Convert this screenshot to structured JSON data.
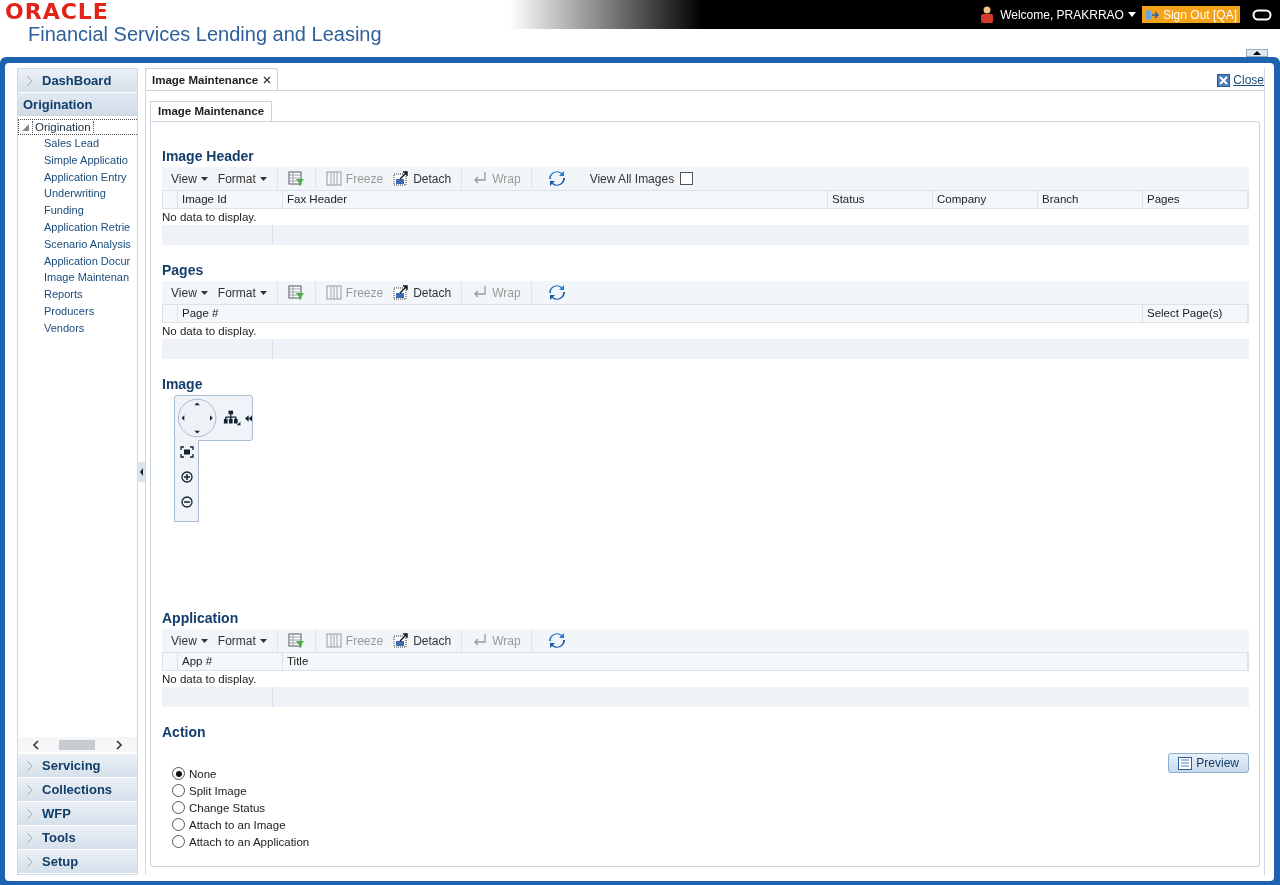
{
  "header": {
    "logo": "ORACLE",
    "product": "Financial Services Lending and Leasing",
    "welcome": "Welcome, PRAKRRAO",
    "sign_out": "Sign Out [QA]"
  },
  "sidebar": {
    "top_sections": [
      {
        "label": "DashBoard"
      }
    ],
    "active_section": "Origination",
    "tree": {
      "label": "Origination",
      "expanded": true,
      "children": [
        {
          "label": "Sales Lead"
        },
        {
          "label": "Simple Applicatio"
        },
        {
          "label": "Application Entry"
        },
        {
          "label": "Underwriting"
        },
        {
          "label": "Funding"
        },
        {
          "label": "Application Retrie"
        },
        {
          "label": "Scenario Analysis"
        },
        {
          "label": "Application Docur"
        },
        {
          "label": "Image Maintenan"
        },
        {
          "label": "Reports"
        },
        {
          "label": "Producers"
        },
        {
          "label": "Vendors"
        }
      ]
    },
    "bottom_sections": [
      {
        "label": "Servicing"
      },
      {
        "label": "Collections"
      },
      {
        "label": "WFP"
      },
      {
        "label": "Tools"
      },
      {
        "label": "Setup"
      }
    ]
  },
  "tabs": [
    {
      "label": "Image Maintenance",
      "selected": true
    }
  ],
  "close_link": "Close",
  "sub_tabs": [
    {
      "label": "Image Maintenance",
      "selected": true
    }
  ],
  "sections": [
    {
      "kind": "table",
      "title": "Image Header",
      "toolbar": [
        {
          "kind": "menu",
          "label": "View"
        },
        {
          "kind": "menu",
          "label": "Format"
        },
        {
          "kind": "filter"
        },
        {
          "kind": "freeze",
          "label": "Freeze",
          "disabled": true
        },
        {
          "kind": "detach",
          "label": "Detach",
          "disabled": false
        },
        {
          "kind": "wrap",
          "label": "Wrap",
          "disabled": true
        },
        {
          "kind": "refresh"
        }
      ],
      "view_all_images": {
        "label": "View All Images",
        "checked": false
      },
      "columns": [
        "Image Id",
        "Fax Header",
        "Status",
        "Company",
        "Branch",
        "Pages"
      ],
      "empty_text": "No data to display."
    },
    {
      "kind": "table",
      "title": "Pages",
      "toolbar": [
        {
          "kind": "menu",
          "label": "View"
        },
        {
          "kind": "menu",
          "label": "Format"
        },
        {
          "kind": "filter"
        },
        {
          "kind": "freeze",
          "label": "Freeze",
          "disabled": true
        },
        {
          "kind": "detach",
          "label": "Detach",
          "disabled": false
        },
        {
          "kind": "wrap",
          "label": "Wrap",
          "disabled": true
        },
        {
          "kind": "refresh"
        }
      ],
      "columns": [
        "Page #",
        "Select Page(s)"
      ],
      "empty_text": "No data to display."
    },
    {
      "kind": "viewer",
      "title": "Image"
    },
    {
      "kind": "table",
      "title": "Application",
      "toolbar": [
        {
          "kind": "menu",
          "label": "View"
        },
        {
          "kind": "menu",
          "label": "Format"
        },
        {
          "kind": "filter"
        },
        {
          "kind": "freeze",
          "label": "Freeze",
          "disabled": true
        },
        {
          "kind": "detach",
          "label": "Detach",
          "disabled": false
        },
        {
          "kind": "wrap",
          "label": "Wrap",
          "disabled": true
        },
        {
          "kind": "refresh"
        }
      ],
      "columns": [
        "App #",
        "Title"
      ],
      "empty_text": "No data to display."
    },
    {
      "kind": "action",
      "title": "Action",
      "button": "Preview",
      "options": [
        {
          "label": "None",
          "selected": true
        },
        {
          "label": "Split Image",
          "selected": false
        },
        {
          "label": "Change Status",
          "selected": false
        },
        {
          "label": "Attach to an Image",
          "selected": false
        },
        {
          "label": "Attach to an Application",
          "selected": false
        }
      ]
    }
  ]
}
